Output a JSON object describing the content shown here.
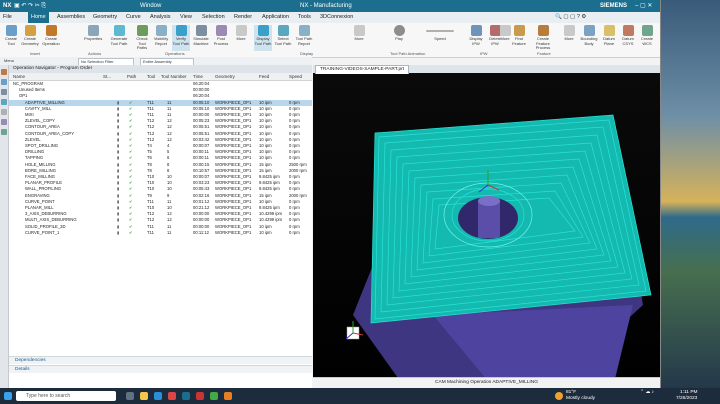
{
  "window": {
    "app_logo": "NX",
    "window_menu": "Window",
    "title": "NX - Manufacturing",
    "brand": "SIEMENS"
  },
  "menu": {
    "file": "File",
    "items": [
      "Home",
      "Assemblies",
      "Geometry",
      "Curve",
      "Analysis",
      "View",
      "Selection",
      "Render",
      "Application",
      "Tools",
      "3DConnexion"
    ]
  },
  "ribbon": {
    "buttons": [
      "Create Tool",
      "Create Geometry",
      "Create Operation",
      "Properties",
      "Generate Tool Path",
      "Check Tool Paths",
      "Visibility Report",
      "Verify Tool Path",
      "Simulate Machine",
      "Post Process",
      "More",
      "Display Tool Path",
      "Select Tool Path",
      "Tool Path Report",
      "More",
      "Play",
      "Speed",
      "Display IPW",
      "Delete IPW",
      "More",
      "Find Feature",
      "Create Feature Process",
      "More",
      "Bounding Body",
      "Datum Plane",
      "Datum CSYS",
      "Create WCS"
    ],
    "groups": [
      "Insert",
      "Actions",
      "Operations",
      "Display",
      "Tool Path Animation",
      "IPW",
      "Feature"
    ]
  },
  "quickbar": {
    "menu": "Menu",
    "filter": "No Selection Filter",
    "scope": "Entire Assembly"
  },
  "navigator": {
    "title": "Operation Navigator - Program Order",
    "columns": [
      "Name",
      "St...",
      "Path",
      "Tool",
      "Tool Number",
      "Time",
      "Geometry",
      "Feed",
      "Speed"
    ],
    "rows": [
      {
        "name": "NC_PROGRAM",
        "time": "06:20:04",
        "geom": "",
        "feed": "",
        "speed": "",
        "tool": "",
        "num": "",
        "indent": 0
      },
      {
        "name": "Unused Items",
        "time": "00:00:00",
        "geom": "",
        "feed": "",
        "speed": "",
        "tool": "",
        "num": "",
        "indent": 1
      },
      {
        "name": "OP1",
        "time": "06:20:04",
        "geom": "",
        "feed": "",
        "speed": "",
        "tool": "",
        "num": "",
        "indent": 1
      },
      {
        "name": "ADAPTIVE_MILLING",
        "time": "00:05:10",
        "geom": "WORKPIECE_OP1",
        "feed": "10 ipm",
        "speed": "0 rpm",
        "tool": "T11",
        "num": "11",
        "indent": 2,
        "selected": true
      },
      {
        "name": "CAVITY_MILL",
        "time": "00:05:10",
        "geom": "WORKPIECE_OP1",
        "feed": "10 ipm",
        "speed": "0 rpm",
        "tool": "T11",
        "num": "11",
        "indent": 2
      },
      {
        "name": "MIXI",
        "time": "00:00:00",
        "geom": "WORKPIECE_OP1",
        "feed": "10 ipm",
        "speed": "0 rpm",
        "tool": "T11",
        "num": "11",
        "indent": 2
      },
      {
        "name": "ZLEVEL_COPY",
        "time": "00:05:23",
        "geom": "WORKPIECE_OP1",
        "feed": "10 ipm",
        "speed": "0 rpm",
        "tool": "T12",
        "num": "12",
        "indent": 2
      },
      {
        "name": "CONTOUR_AREA",
        "time": "00:05:51",
        "geom": "WORKPIECE_OP1",
        "feed": "10 ipm",
        "speed": "0 rpm",
        "tool": "T12",
        "num": "12",
        "indent": 2
      },
      {
        "name": "CONTOUR_AREA_COPY",
        "time": "00:05:51",
        "geom": "WORKPIECE_OP1",
        "feed": "10 ipm",
        "speed": "0 rpm",
        "tool": "T12",
        "num": "12",
        "indent": 2
      },
      {
        "name": "ZLEVEL",
        "time": "00:03:42",
        "geom": "WORKPIECE_OP1",
        "feed": "10 ipm",
        "speed": "0 rpm",
        "tool": "T12",
        "num": "12",
        "indent": 2
      },
      {
        "name": "SPOT_DRILLING",
        "time": "00:00:07",
        "geom": "WORKPIECE_OP1",
        "feed": "10 ipm",
        "speed": "0 rpm",
        "tool": "T4",
        "num": "4",
        "indent": 2
      },
      {
        "name": "DRILLING",
        "time": "00:00:11",
        "geom": "WORKPIECE_OP1",
        "feed": "10 ipm",
        "speed": "0 rpm",
        "tool": "T5",
        "num": "5",
        "indent": 2
      },
      {
        "name": "TAPPING",
        "time": "00:00:11",
        "geom": "WORKPIECE_OP1",
        "feed": "10 ipm",
        "speed": "0 rpm",
        "tool": "T6",
        "num": "6",
        "indent": 2
      },
      {
        "name": "HOLE_MILLING",
        "time": "00:00:15",
        "geom": "WORKPIECE_OP1",
        "feed": "15 ipm",
        "speed": "2500 rpm",
        "tool": "T8",
        "num": "8",
        "indent": 2
      },
      {
        "name": "BORE_MILLING",
        "time": "00:10:57",
        "geom": "WORKPIECE_OP1",
        "feed": "15 ipm",
        "speed": "2000 rpm",
        "tool": "T8",
        "num": "8",
        "indent": 2
      },
      {
        "name": "FACE_MILLING",
        "time": "00:00:07",
        "geom": "WORKPIECE_OP1",
        "feed": "9.8425 ipm",
        "speed": "0 rpm",
        "tool": "T10",
        "num": "10",
        "indent": 2
      },
      {
        "name": "PLANAR_PROFILE",
        "time": "00:03:23",
        "geom": "WORKPIECE_OP1",
        "feed": "9.8425 ipm",
        "speed": "0 rpm",
        "tool": "T10",
        "num": "10",
        "indent": 2
      },
      {
        "name": "WALL_PROFILING",
        "time": "00:05:43",
        "geom": "WORKPIECE_OP1",
        "feed": "9.8425 ipm",
        "speed": "0 rpm",
        "tool": "T10",
        "num": "10",
        "indent": 2
      },
      {
        "name": "ENGRAVING",
        "time": "00:02:16",
        "geom": "WORKPIECE_OP1",
        "feed": "15 ipm",
        "speed": "2000 rpm",
        "tool": "T9",
        "num": "9",
        "indent": 2
      },
      {
        "name": "CURVE_POINT",
        "time": "00:01:12",
        "geom": "WORKPIECE_OP1",
        "feed": "10 ipm",
        "speed": "0 rpm",
        "tool": "T11",
        "num": "11",
        "indent": 2
      },
      {
        "name": "PLANAR_MILL",
        "time": "00:21:12",
        "geom": "WORKPIECE_OP1",
        "feed": "9.8425 ipm",
        "speed": "0 rpm",
        "tool": "T10",
        "num": "10",
        "indent": 2
      },
      {
        "name": "3_AXIS_DEBURRING",
        "time": "00:00:00",
        "geom": "WORKPIECE_OP1",
        "feed": "10.4299 ipm",
        "speed": "0 rpm",
        "tool": "T12",
        "num": "12",
        "indent": 2
      },
      {
        "name": "MULTI_AXIS_DEBURRING",
        "time": "00:00:00",
        "geom": "WORKPIECE_OP1",
        "feed": "10.4299 ipm",
        "speed": "0 rpm",
        "tool": "T12",
        "num": "12",
        "indent": 2
      },
      {
        "name": "SOLID_PROFILE_3D",
        "time": "00:00:00",
        "geom": "WORKPIECE_OP1",
        "feed": "10 ipm",
        "speed": "0 rpm",
        "tool": "T11",
        "num": "11",
        "indent": 2
      },
      {
        "name": "CURVE_POINT_1",
        "time": "00:11:12",
        "geom": "WORKPIECE_OP1",
        "feed": "10 ipm",
        "speed": "0 rpm",
        "tool": "T11",
        "num": "11",
        "indent": 2
      }
    ],
    "dependencies": "Dependencies",
    "details": "Details"
  },
  "graphics": {
    "tab": "TRAINING-VIDEOS-SAMPLE-PART.prt",
    "status": "CAM Machining Operation ADAPTIVE_MILLING"
  },
  "taskbar": {
    "search_placeholder": "Type here to search",
    "temp": "81°F",
    "weather": "Mostly cloudy",
    "time": "1:11 PM",
    "date": "7/26/2023"
  },
  "colors": {
    "accent": "#1b6e8e",
    "toolpath": "#27e3d6",
    "part": "#4a3f8e",
    "selected_row": "#b9d7ec"
  }
}
